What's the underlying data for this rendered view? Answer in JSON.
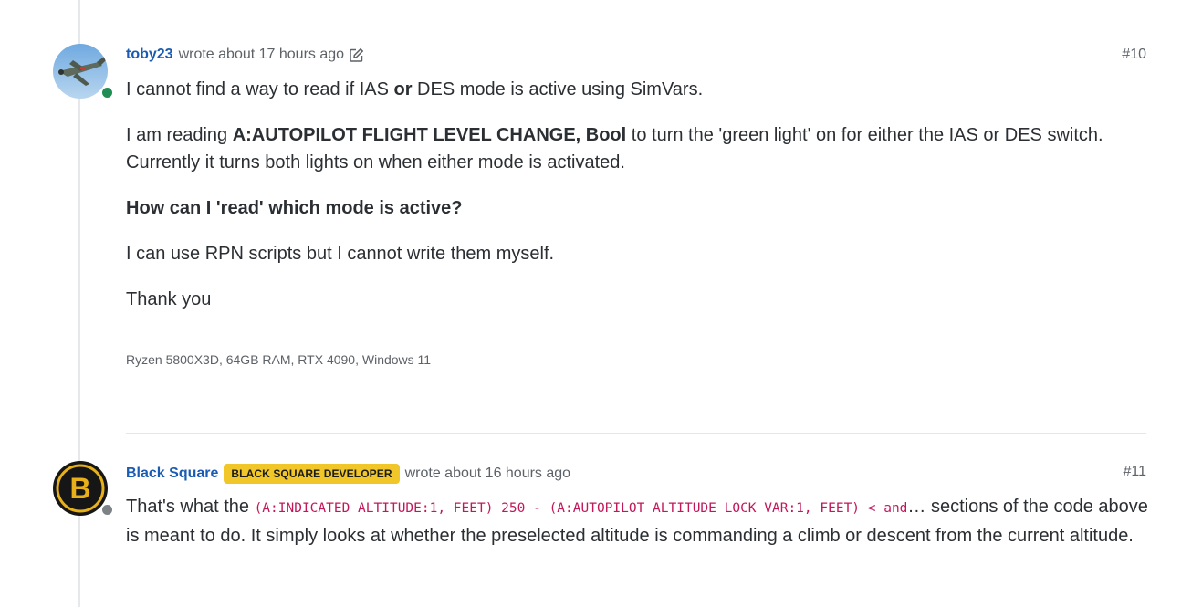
{
  "post1": {
    "username": "toby23",
    "meta": "wrote about 17 hours ago",
    "number": "#10",
    "para1_a": "I cannot find a way to read if IAS ",
    "para1_bold": "or",
    "para1_b": " DES mode is active using SimVars.",
    "para2_a": "I am reading ",
    "para2_bold": "A:AUTOPILOT FLIGHT LEVEL CHANGE, Bool",
    "para2_b": " to turn the 'green light' on for either the IAS or DES switch. Currently it turns both lights on when either mode is activated.",
    "para3_bold": "How can I 'read' which mode is active?",
    "para4": "I can use RPN scripts but I cannot write them myself.",
    "para5": "Thank you",
    "signature": "Ryzen 5800X3D, 64GB RAM, RTX 4090, Windows 11",
    "status_color": "#1e8e53"
  },
  "post2": {
    "username": "Black Square",
    "badge": "BLACK SQUARE DEVELOPER",
    "meta": "wrote about 16 hours ago",
    "number": "#11",
    "text_a": "That's what the ",
    "code": "(A:INDICATED ALTITUDE:1, FEET) 250 - (A:AUTOPILOT ALTITUDE LOCK VAR:1, FEET) < and",
    "text_b": "… sections of the code above is meant to do. It simply looks at whether the preselected altitude is commanding a climb or descent from the current altitude.",
    "status_color": "#7d8287",
    "avatar_letter": "B"
  },
  "colors": {
    "link": "#1a5bb3",
    "badge": "#f0c628",
    "code": "#c2185b"
  },
  "icons": [
    "edit-icon",
    "airplane-avatar",
    "letter-b-avatar"
  ]
}
